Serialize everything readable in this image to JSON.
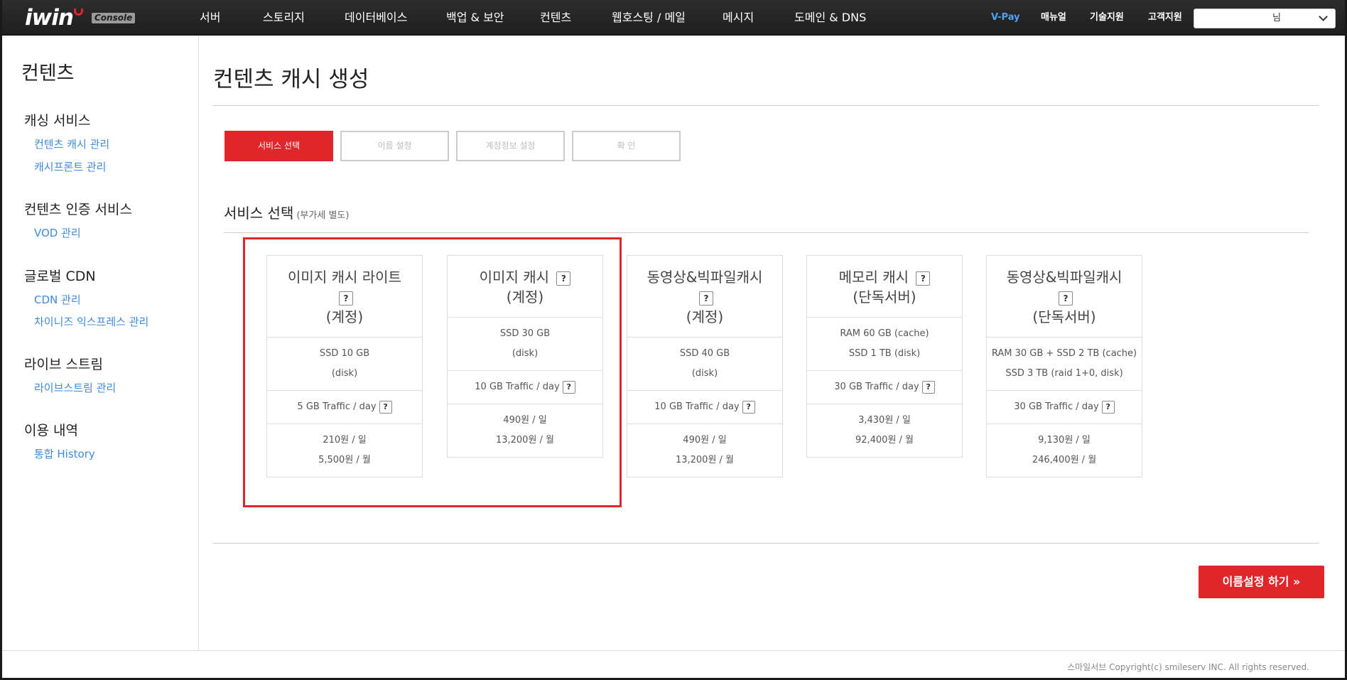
{
  "brand": {
    "logo": "iwin",
    "badge": "Console",
    "accent_color": "#e0262b",
    "link_color": "#3f8bd9"
  },
  "nav": {
    "items": [
      "서버",
      "스토리지",
      "데이터베이스",
      "백업 & 보안",
      "컨텐츠",
      "웹호스팅 / 메일",
      "메시지",
      "도메인 & DNS"
    ],
    "right": [
      "V-Pay",
      "매뉴얼",
      "기술지원",
      "고객지원"
    ],
    "user_suffix": "님"
  },
  "sidebar": {
    "title": "컨텐츠",
    "groups": [
      {
        "label": "캐싱 서비스",
        "links": [
          "컨텐츠 캐시 관리",
          "캐시프론트 관리"
        ]
      },
      {
        "label": "컨텐츠 인증 서비스",
        "links": [
          "VOD 관리"
        ]
      },
      {
        "label": "글로벌 CDN",
        "links": [
          "CDN 관리",
          "차이니즈 익스프레스 관리"
        ]
      },
      {
        "label": "라이브 스트림",
        "links": [
          "라이브스트림 관리"
        ]
      },
      {
        "label": "이용 내역",
        "links": [
          "통합 History"
        ]
      }
    ]
  },
  "main": {
    "title": "컨텐츠 캐시 생성",
    "steps": [
      "서비스 선택",
      "이름 설정",
      "계정정보 설정",
      "확  인"
    ],
    "section_title": "서비스 선택",
    "section_sub": "(부가세 별도)",
    "cards": [
      {
        "name": "이미지 캐시 라이트",
        "type": "(계정)",
        "spec1": "SSD 10 GB",
        "spec2": "(disk)",
        "traffic": "5 GB Traffic / day",
        "price_day": "210원 / 일",
        "price_month": "5,500원 / 월"
      },
      {
        "name": "이미지 캐시",
        "type": "(계정)",
        "spec1": "SSD 30 GB",
        "spec2": "(disk)",
        "traffic": "10 GB Traffic / day",
        "price_day": "490원 / 일",
        "price_month": "13,200원 / 월"
      },
      {
        "name": "동영상&빅파일캐시",
        "type": "(계정)",
        "spec1": "SSD 40 GB",
        "spec2": "(disk)",
        "traffic": "10 GB Traffic / day",
        "price_day": "490원 / 일",
        "price_month": "13,200원 / 월"
      },
      {
        "name": "메모리 캐시",
        "type": "(단독서버)",
        "spec1": "RAM 60 GB (cache)",
        "spec2": "SSD 1 TB (disk)",
        "traffic": "30 GB Traffic / day",
        "price_day": "3,430원 / 일",
        "price_month": "92,400원 / 월"
      },
      {
        "name": "동영상&빅파일캐시",
        "type": "(단독서버)",
        "spec1": "RAM 30 GB + SSD 2 TB (cache)",
        "spec2": "SSD 3 TB (raid 1+0, disk)",
        "traffic": "30 GB Traffic / day",
        "price_day": "9,130원 / 일",
        "price_month": "246,400원 / 월"
      }
    ],
    "help_mark": "?",
    "next_button": "이름설정 하기 »"
  },
  "footer": {
    "copyright": "스마일서브 Copyright(c) smileserv INC. All rights reserved."
  }
}
